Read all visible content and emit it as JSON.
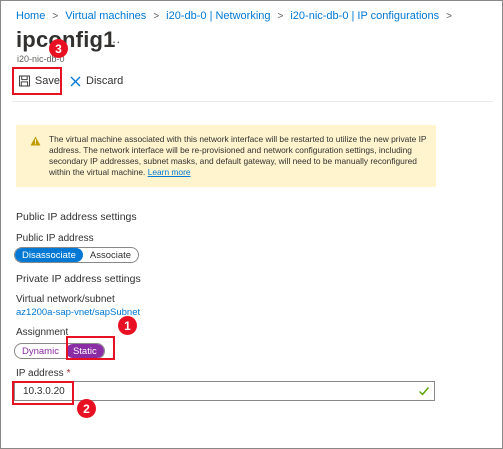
{
  "breadcrumb": {
    "items": [
      "Home",
      "Virtual machines",
      "i20-db-0 | Networking",
      "i20-nic-db-0 | IP configurations"
    ],
    "separator": ">"
  },
  "header": {
    "title": "ipconfig1",
    "more": "...",
    "subtitle": "i20-nic-db-0"
  },
  "toolbar": {
    "save_label": "Save",
    "discard_label": "Discard"
  },
  "warning": {
    "text": "The virtual machine associated with this network interface will be restarted to utilize the new private IP address. The network interface will be re-provisioned and network configuration settings, including secondary IP addresses, subnet masks, and default gateway, will need to be manually reconfigured within the virtual machine.",
    "link": "Learn more"
  },
  "public_ip": {
    "section_title": "Public IP address settings",
    "label": "Public IP address",
    "options": [
      "Disassociate",
      "Associate"
    ],
    "selected": "Disassociate"
  },
  "private_ip": {
    "section_title": "Private IP address settings",
    "vnet_label": "Virtual network/subnet",
    "vnet_value": "az1200a-sap-vnet/sapSubnet",
    "assignment_label": "Assignment",
    "assignment_options": [
      "Dynamic",
      "Static"
    ],
    "assignment_selected": "Static",
    "ip_label": "IP address",
    "ip_required": "*",
    "ip_value": "10.3.0.20"
  },
  "annotations": {
    "step1": "1",
    "step2": "2",
    "step3": "3"
  },
  "colors": {
    "accent": "#0078d4",
    "highlight": "#e81123",
    "static_selected": "#8a2da5",
    "warning_bg": "#fff4ce"
  }
}
